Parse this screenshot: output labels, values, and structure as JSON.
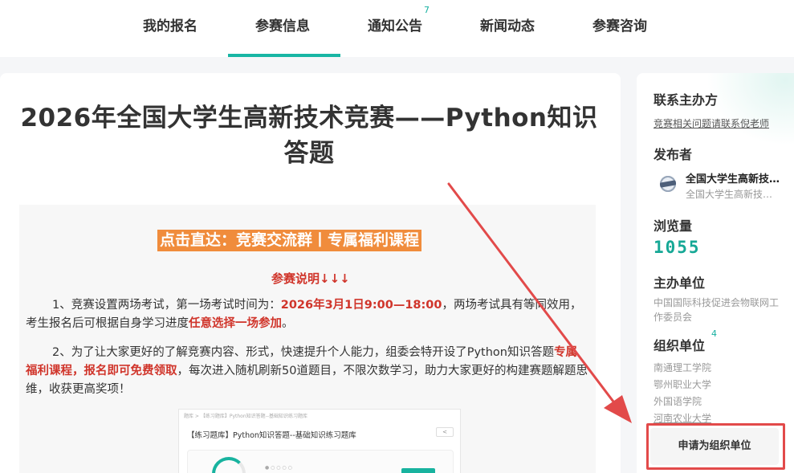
{
  "nav": {
    "items": [
      {
        "label": "我的报名"
      },
      {
        "label": "参赛信息"
      },
      {
        "label": "通知公告",
        "badge": "7"
      },
      {
        "label": "新闻动态"
      },
      {
        "label": "参赛咨询"
      }
    ],
    "active_index": 1
  },
  "main": {
    "title": "2026年全国大学生高新技术竞赛——Python知识答题",
    "promo_link": "点击直达：竞赛交流群丨专属福利课程",
    "notice_heading": "参赛说明↓↓↓",
    "paragraph1": {
      "part1": "1、竞赛设置两场考试，第一场考试时间为：",
      "time": "2026年3月1日9:00—18:00",
      "part2": "，两场考试具有等同效用，考生报名后可根据自身学习进度",
      "choice": "任意选择一场参加",
      "part3": "。"
    },
    "paragraph2": {
      "part1": "2、为了让大家更好的了解竞赛内容、形式，快速提升个人能力，组委会特开设了Python知识答题",
      "perk": "专属福利课程，报名即可免费领取",
      "part2": "，每次进入随机刷新50道题目，不限次数学习，助力大家更好的构建赛题解题思维，收获更高奖项！"
    },
    "preview": {
      "breadcrumb": "题库 > 【练习题库】Python知识答题--基础知识练习题库",
      "heading": "【练习题库】Python知识答题--基础知识练习题库"
    }
  },
  "sidebar": {
    "contact_heading": "联系主办方",
    "contact_link": "竞赛相关问题请联系倪老师",
    "publisher_heading": "发布者",
    "publisher_name": "全国大学生高新技术竞赛",
    "publisher_desc": "全国大学生高新技术竞赛组委会",
    "views_heading": "浏览量",
    "views": "1055",
    "host_heading": "主办单位",
    "host": "中国国际科技促进会物联网工作委员会",
    "org_heading": "组织单位",
    "org_count": "4",
    "orgs": [
      "南通理工学院",
      "鄂州职业大学",
      "外国语学院",
      "河南农业大学"
    ],
    "apply_button": "申请为组织单位"
  },
  "colors": {
    "accent": "#19b6a4",
    "alert_red": "#d0352b",
    "promo_bg": "#f08c3c",
    "annotation": "#e24a4a"
  }
}
